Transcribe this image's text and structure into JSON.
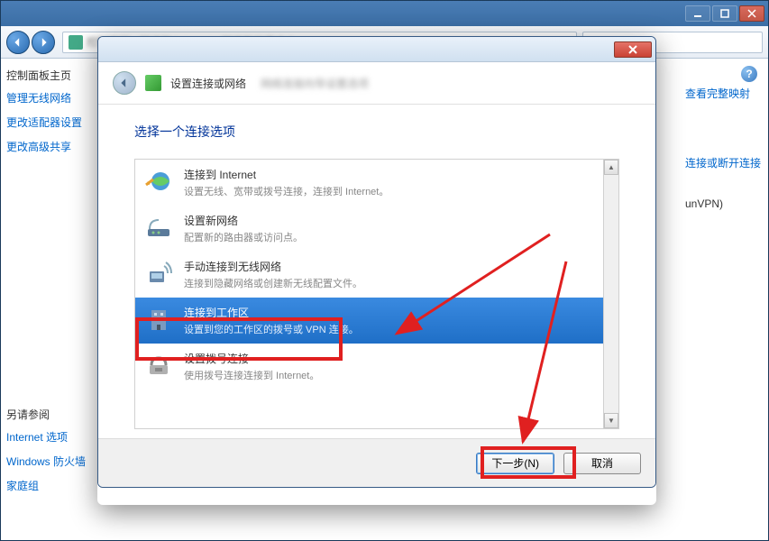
{
  "main_window": {
    "sidebar": {
      "heading": "控制面板主页",
      "links": [
        "管理无线网络",
        "更改适配器设置",
        "更改高级共享"
      ],
      "see_also_heading": "另请参阅",
      "see_also_links": [
        "Internet 选项",
        "Windows 防火墙",
        "家庭组"
      ]
    },
    "right_links": [
      "查看完整映射",
      "连接或断开连接",
      "unVPN)"
    ]
  },
  "dialog": {
    "title": "设置连接或网络",
    "subtitle": "选择一个连接选项",
    "options": [
      {
        "title": "连接到 Internet",
        "desc": "设置无线、宽带或拨号连接，连接到 Internet。",
        "selected": false
      },
      {
        "title": "设置新网络",
        "desc": "配置新的路由器或访问点。",
        "selected": false
      },
      {
        "title": "手动连接到无线网络",
        "desc": "连接到隐藏网络或创建新无线配置文件。",
        "selected": false
      },
      {
        "title": "连接到工作区",
        "desc": "设置到您的工作区的拨号或 VPN 连接。",
        "selected": true
      },
      {
        "title": "设置拨号连接",
        "desc": "使用拨号连接连接到 Internet。",
        "selected": false
      }
    ],
    "next_btn": "下一步(N)",
    "cancel_btn": "取消"
  }
}
